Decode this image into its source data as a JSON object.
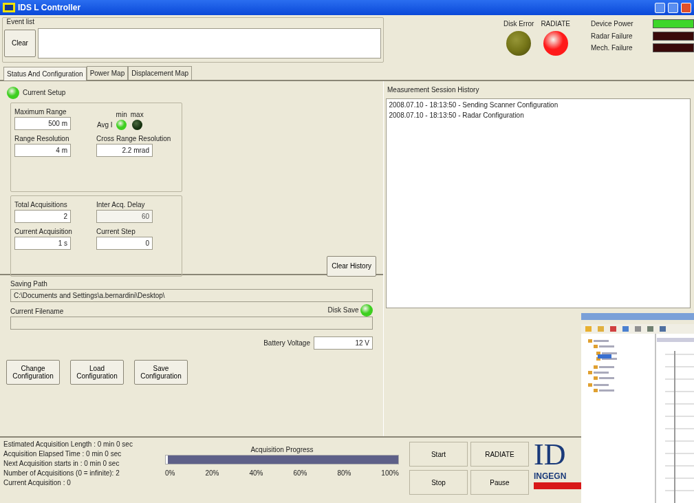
{
  "window": {
    "title": "IDS L Controller"
  },
  "event_list": {
    "label": "Event list",
    "clear_button": "Clear"
  },
  "lamps": [
    {
      "label": "Disk Error",
      "on": false,
      "color": "#8a8a1c"
    },
    {
      "label": "RADIATE",
      "on": true,
      "color": "#ff1a1a"
    }
  ],
  "status_bars": [
    {
      "label": "Device Power",
      "on": true
    },
    {
      "label": "Radar Failure",
      "on": false
    },
    {
      "label": "Mech. Failure",
      "on": false
    }
  ],
  "tabs": [
    {
      "label": "Status And Configuration",
      "selected": true
    },
    {
      "label": "Power Map",
      "selected": false
    },
    {
      "label": "Displacement Map",
      "selected": false
    }
  ],
  "current_setup": {
    "label": "Current Setup",
    "on": true
  },
  "setup_fields": [
    {
      "label": "Maximum Range",
      "value": "500 m"
    },
    {
      "label": "Range Resolution",
      "value": "4 m"
    },
    {
      "label": "Cross Range Resolution",
      "value": "2.2 mrad"
    }
  ],
  "avg": {
    "label": "Avg I",
    "min_label": "min",
    "max_label": "max",
    "min_on": true,
    "max_on": false
  },
  "acq_fields": [
    {
      "label": "Total Acquisitions",
      "value": "2",
      "disabled": false
    },
    {
      "label": "Inter Acq. Delay",
      "value": "60",
      "disabled": true
    },
    {
      "label": "Current Acquisition",
      "value": "1 s",
      "disabled": false
    },
    {
      "label": "Current Step",
      "value": "0",
      "disabled": false
    }
  ],
  "clear_history": "Clear History",
  "saving_path": {
    "label": "Saving Path",
    "value": "C:\\Documents and Settings\\a.bernardini\\Desktop\\"
  },
  "current_filename": {
    "label": "Current Filename"
  },
  "disk_save": {
    "label": "Disk Save",
    "on": true
  },
  "battery": {
    "label": "Battery Voltage",
    "value": "12 V"
  },
  "config_buttons": [
    "Change Configuration",
    "Load Configuration",
    "Save Configuration"
  ],
  "history": {
    "label": "Measurement Session History",
    "lines": [
      "2008.07.10 - 18:13:50 - Sending Scanner Configuration",
      "2008.07.10 - 18:13:50 - Radar Configuration"
    ]
  },
  "status_lines": [
    "Estimated Acquisition Length : 0 min 0 sec",
    "Acquisition Elapsed Time : 0 min 0 sec",
    "Next Acquisition starts in : 0 min 0 sec",
    "Number of Acquisitions (0 = infinite): 2",
    "Current Acquisition : 0"
  ],
  "progress": {
    "label": "Acquisition Progress",
    "level": 0.01,
    "ticks": [
      "0%",
      "20%",
      "40%",
      "60%",
      "80%",
      "100%"
    ]
  },
  "action_buttons": [
    "Start",
    "RADIATE",
    "Stop",
    "Pause"
  ],
  "logo": {
    "mark": "ID",
    "subtitle": "INGEGN"
  }
}
